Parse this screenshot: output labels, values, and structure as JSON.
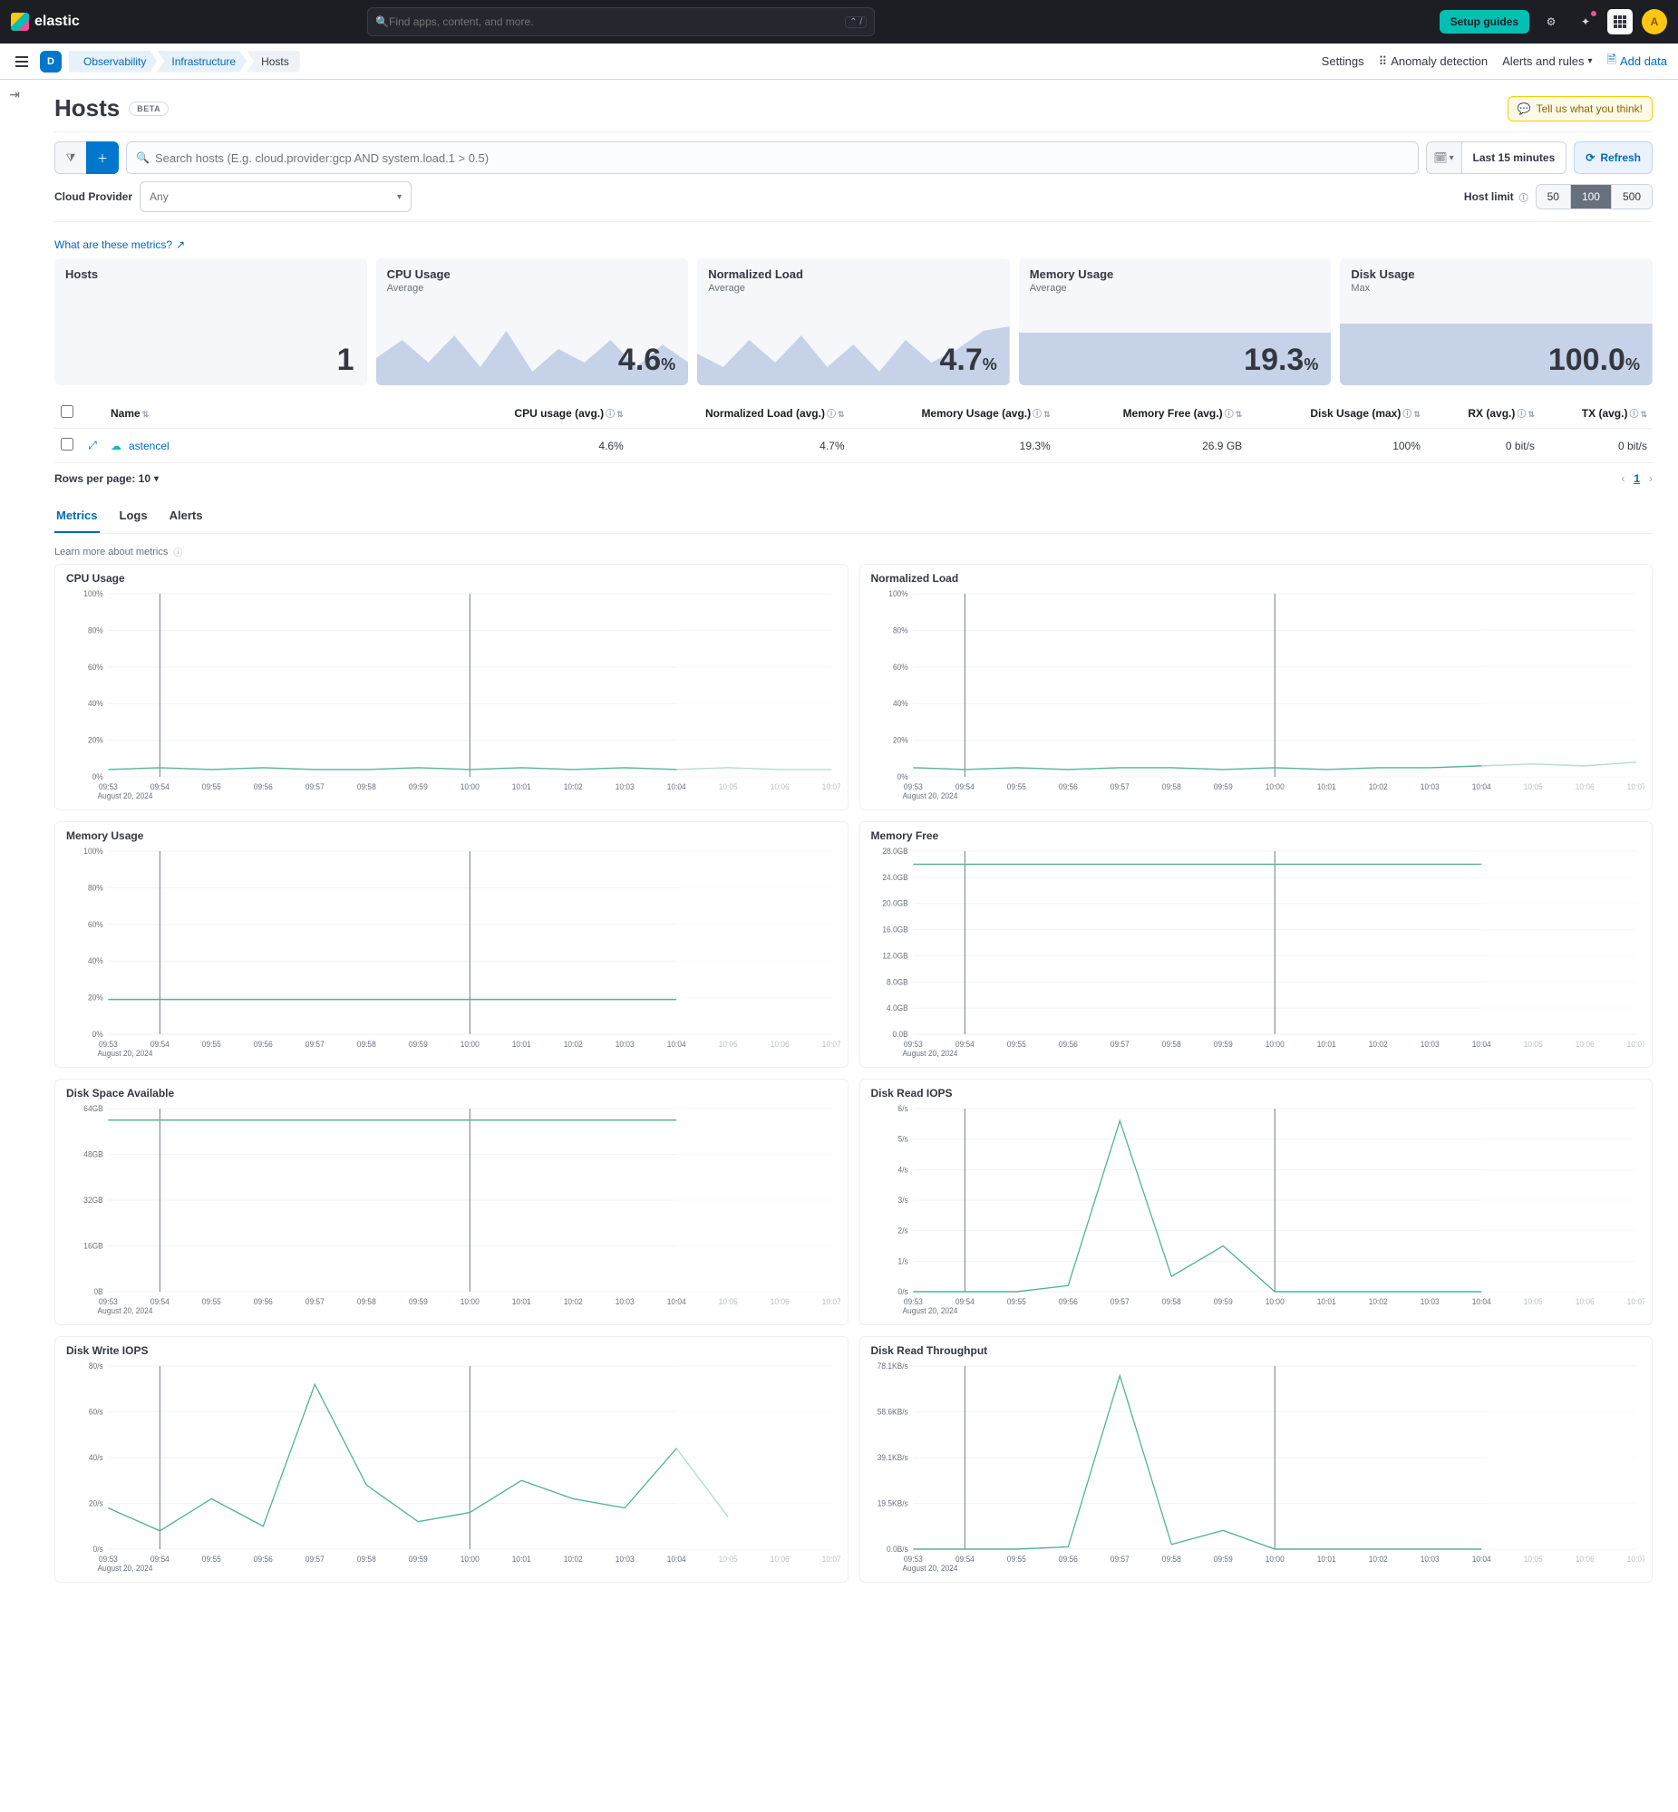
{
  "brand": "elastic",
  "topSearch": {
    "placeholder": "Find apps, content, and more.",
    "kbd": "⌃ /"
  },
  "setupGuides": "Setup guides",
  "avatarInitial": "A",
  "subnav": {
    "home": "D",
    "breadcrumbs": [
      "Observability",
      "Infrastructure",
      "Hosts"
    ],
    "settings": "Settings",
    "anomaly": "Anomaly detection",
    "alertsRules": "Alerts and rules",
    "addData": "Add data"
  },
  "title": "Hosts",
  "beta": "BETA",
  "feedback": "Tell us what you think!",
  "query": {
    "placeholder": "Search hosts (E.g. cloud.provider:gcp AND system.load.1 > 0.5)"
  },
  "datePicker": "Last 15 minutes",
  "refresh": "Refresh",
  "cloudProvider": {
    "label": "Cloud Provider",
    "value": "Any"
  },
  "hostLimit": {
    "label": "Host limit",
    "options": [
      "50",
      "100",
      "500"
    ],
    "active": "100"
  },
  "metricsLink": "What are these metrics?",
  "kpis": [
    {
      "title": "Hosts",
      "sub": "",
      "value": "1",
      "unit": ""
    },
    {
      "title": "CPU Usage",
      "sub": "Average",
      "value": "4.6",
      "unit": "%"
    },
    {
      "title": "Normalized Load",
      "sub": "Average",
      "value": "4.7",
      "unit": "%"
    },
    {
      "title": "Memory Usage",
      "sub": "Average",
      "value": "19.3",
      "unit": "%"
    },
    {
      "title": "Disk Usage",
      "sub": "Max",
      "value": "100.0",
      "unit": "%"
    }
  ],
  "columns": [
    "",
    "",
    "Name",
    "CPU usage (avg.)",
    "Normalized Load (avg.)",
    "Memory Usage (avg.)",
    "Memory Free (avg.)",
    "Disk Usage (max)",
    "RX (avg.)",
    "TX (avg.)"
  ],
  "rows": [
    {
      "name": "astencel",
      "cpu": "4.6%",
      "norm": "4.7%",
      "mem": "19.3%",
      "free": "26.9 GB",
      "disk": "100%",
      "rx": "0 bit/s",
      "tx": "0 bit/s"
    }
  ],
  "rowsPerPage": "Rows per page: 10",
  "pageNumber": "1",
  "tabs": [
    "Metrics",
    "Logs",
    "Alerts"
  ],
  "activeTab": "Metrics",
  "learnMore": "Learn more about metrics",
  "chart_data": [
    {
      "id": "cpu",
      "title": "CPU Usage",
      "type": "line",
      "ylabel": "",
      "yticks": [
        "0%",
        "20%",
        "40%",
        "60%",
        "80%",
        "100%"
      ],
      "ylim": [
        0,
        100
      ],
      "x": [
        "09:53",
        "09:54",
        "09:55",
        "09:56",
        "09:57",
        "09:58",
        "09:59",
        "10:00",
        "10:01",
        "10:02",
        "10:03",
        "10:04",
        "10:05",
        "10:06",
        "10:07"
      ],
      "subdate": "August 20, 2024",
      "values": [
        4,
        5,
        4,
        5,
        4,
        4,
        5,
        4,
        5,
        4,
        5,
        4,
        5,
        4,
        4
      ],
      "markers": [
        "09:54",
        "10:00"
      ],
      "dim_after": "10:04"
    },
    {
      "id": "normload",
      "title": "Normalized Load",
      "type": "line",
      "yticks": [
        "0%",
        "20%",
        "40%",
        "60%",
        "80%",
        "100%"
      ],
      "ylim": [
        0,
        100
      ],
      "x": [
        "09:53",
        "09:54",
        "09:55",
        "09:56",
        "09:57",
        "09:58",
        "09:59",
        "10:00",
        "10:01",
        "10:02",
        "10:03",
        "10:04",
        "10:05",
        "10:06",
        "10:07"
      ],
      "subdate": "August 20, 2024",
      "values": [
        5,
        4,
        5,
        4,
        5,
        5,
        4,
        5,
        4,
        5,
        5,
        6,
        7,
        6,
        8
      ],
      "markers": [
        "09:54",
        "10:00"
      ],
      "dim_after": "10:04"
    },
    {
      "id": "memuse",
      "title": "Memory Usage",
      "type": "line",
      "yticks": [
        "0%",
        "20%",
        "40%",
        "60%",
        "80%",
        "100%"
      ],
      "ylim": [
        0,
        100
      ],
      "x": [
        "09:53",
        "09:54",
        "09:55",
        "09:56",
        "09:57",
        "09:58",
        "09:59",
        "10:00",
        "10:01",
        "10:02",
        "10:03",
        "10:04",
        "10:05",
        "10:06",
        "10:07"
      ],
      "subdate": "August 20, 2024",
      "values": [
        19,
        19,
        19,
        19,
        19,
        19,
        19,
        19,
        19,
        19,
        19,
        19,
        null,
        null,
        null
      ],
      "markers": [
        "09:54",
        "10:00"
      ],
      "dim_after": "10:04"
    },
    {
      "id": "memfree",
      "title": "Memory Free",
      "type": "line",
      "yticks": [
        "0.0B",
        "4.0GB",
        "8.0GB",
        "12.0GB",
        "16.0GB",
        "20.0GB",
        "24.0GB",
        "28.0GB"
      ],
      "ylim": [
        0,
        28
      ],
      "x": [
        "09:53",
        "09:54",
        "09:55",
        "09:56",
        "09:57",
        "09:58",
        "09:59",
        "10:00",
        "10:01",
        "10:02",
        "10:03",
        "10:04",
        "10:05",
        "10:06",
        "10:07"
      ],
      "subdate": "August 20, 2024",
      "values": [
        26,
        26,
        26,
        26,
        26,
        26,
        26,
        26,
        26,
        26,
        26,
        26,
        null,
        null,
        null
      ],
      "markers": [
        "09:54",
        "10:00"
      ],
      "dim_after": "10:04"
    },
    {
      "id": "diskavail",
      "title": "Disk Space Available",
      "type": "line",
      "yticks": [
        "0B",
        "16GB",
        "32GB",
        "48GB",
        "64GB"
      ],
      "ylim": [
        0,
        64
      ],
      "x": [
        "09:53",
        "09:54",
        "09:55",
        "09:56",
        "09:57",
        "09:58",
        "09:59",
        "10:00",
        "10:01",
        "10:02",
        "10:03",
        "10:04",
        "10:05",
        "10:06",
        "10:07"
      ],
      "subdate": "August 20, 2024",
      "values": [
        60,
        60,
        60,
        60,
        60,
        60,
        60,
        60,
        60,
        60,
        60,
        60,
        null,
        null,
        null
      ],
      "markers": [
        "09:54",
        "10:00"
      ],
      "dim_after": "10:04"
    },
    {
      "id": "diskriops",
      "title": "Disk Read IOPS",
      "type": "line",
      "yticks": [
        "0/s",
        "1/s",
        "2/s",
        "3/s",
        "4/s",
        "5/s",
        "6/s"
      ],
      "ylim": [
        0,
        6
      ],
      "x": [
        "09:53",
        "09:54",
        "09:55",
        "09:56",
        "09:57",
        "09:58",
        "09:59",
        "10:00",
        "10:01",
        "10:02",
        "10:03",
        "10:04",
        "10:05",
        "10:06",
        "10:07"
      ],
      "subdate": "August 20, 2024",
      "values": [
        0,
        0,
        0,
        0.2,
        5.6,
        0.5,
        1.5,
        0,
        0,
        0,
        0,
        0,
        null,
        null,
        null
      ],
      "markers": [
        "09:54",
        "10:00"
      ],
      "dim_after": "10:04"
    },
    {
      "id": "diskwiops",
      "title": "Disk Write IOPS",
      "type": "line",
      "yticks": [
        "0/s",
        "20/s",
        "40/s",
        "60/s",
        "80/s"
      ],
      "ylim": [
        0,
        80
      ],
      "x": [
        "09:53",
        "09:54",
        "09:55",
        "09:56",
        "09:57",
        "09:58",
        "09:59",
        "10:00",
        "10:01",
        "10:02",
        "10:03",
        "10:04",
        "10:05",
        "10:06",
        "10:07"
      ],
      "subdate": "August 20, 2024",
      "values": [
        18,
        8,
        22,
        10,
        72,
        28,
        12,
        16,
        30,
        22,
        18,
        44,
        14,
        null,
        null
      ],
      "markers": [
        "09:54",
        "10:00"
      ],
      "dim_after": "10:04"
    },
    {
      "id": "diskrtp",
      "title": "Disk Read Throughput",
      "type": "line",
      "yticks": [
        "0.0B/s",
        "19.5KB/s",
        "39.1KB/s",
        "58.6KB/s",
        "78.1KB/s"
      ],
      "ylim": [
        0,
        78.1
      ],
      "x": [
        "09:53",
        "09:54",
        "09:55",
        "09:56",
        "09:57",
        "09:58",
        "09:59",
        "10:00",
        "10:01",
        "10:02",
        "10:03",
        "10:04",
        "10:05",
        "10:06",
        "10:07"
      ],
      "subdate": "August 20, 2024",
      "values": [
        0,
        0,
        0,
        1,
        74,
        2,
        8,
        0,
        0,
        0,
        0,
        0,
        null,
        null,
        null
      ],
      "markers": [
        "09:54",
        "10:00"
      ],
      "dim_after": "10:04"
    }
  ]
}
